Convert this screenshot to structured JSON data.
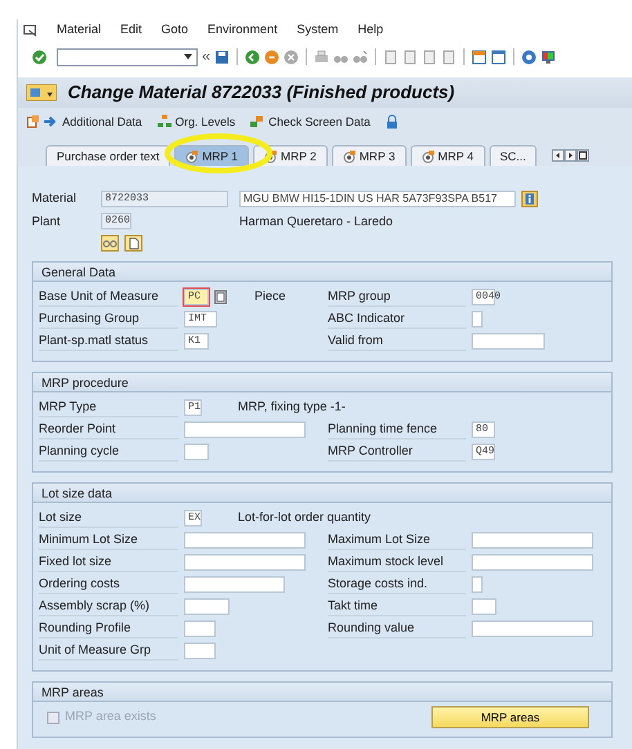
{
  "menu": [
    "Material",
    "Edit",
    "Goto",
    "Environment",
    "System",
    "Help"
  ],
  "toolbar": {
    "history_glyph": "«"
  },
  "title": "Change Material 8722033 (Finished products)",
  "app_toolbar": [
    "Additional Data",
    "Org. Levels",
    "Check Screen Data"
  ],
  "tabs": [
    {
      "label": "Purchase order text",
      "selected": false,
      "kind": "plain"
    },
    {
      "label": "MRP 1",
      "selected": true,
      "kind": "icon"
    },
    {
      "label": "MRP 2",
      "selected": false,
      "kind": "icon"
    },
    {
      "label": "MRP 3",
      "selected": false,
      "kind": "icon"
    },
    {
      "label": "MRP 4",
      "selected": false,
      "kind": "icon"
    },
    {
      "label": "SC...",
      "selected": false,
      "kind": "plain"
    }
  ],
  "header": {
    "material_label": "Material",
    "material": "8722033",
    "description": "MGU BMW HI15-1DIN US HAR 5A73F93SPA B517",
    "plant_label": "Plant",
    "plant": "0260",
    "plant_name": "Harman Queretaro - Laredo"
  },
  "sections": [
    {
      "title": "General Data",
      "rows": [
        {
          "left": {
            "label": "Base Unit of Measure",
            "value": "PC",
            "text": "Piece",
            "focused": true
          },
          "right": {
            "label": "MRP group",
            "value": "0040"
          }
        },
        {
          "left": {
            "label": "Purchasing Group",
            "value": "IMT"
          },
          "right": {
            "label": "ABC Indicator"
          }
        },
        {
          "left": {
            "label": "Plant-sp.matl status",
            "value": "K1"
          },
          "right": {
            "label": "Valid from"
          }
        }
      ]
    },
    {
      "title": "MRP procedure",
      "rows": [
        {
          "left": {
            "label": "MRP Type",
            "value": "P1",
            "text": "MRP, fixing type -1-"
          }
        },
        {
          "left": {
            "label": "Reorder Point"
          },
          "right": {
            "label": "Planning time fence",
            "value": "80"
          }
        },
        {
          "left": {
            "label": "Planning cycle"
          },
          "right": {
            "label": "MRP Controller",
            "value": "Q49"
          }
        }
      ]
    },
    {
      "title": "Lot size data",
      "rows": [
        {
          "left": {
            "label": "Lot size",
            "value": "EX",
            "text": "Lot-for-lot order quantity"
          }
        },
        {
          "left": {
            "label": "Minimum Lot Size"
          },
          "right": {
            "label": "Maximum Lot Size"
          }
        },
        {
          "left": {
            "label": "Fixed lot size"
          },
          "right": {
            "label": "Maximum stock level"
          }
        },
        {
          "left": {
            "label": "Ordering costs"
          },
          "right": {
            "label": "Storage costs ind."
          }
        },
        {
          "left": {
            "label": "Assembly scrap (%)"
          },
          "right": {
            "label": "Takt time"
          }
        },
        {
          "left": {
            "label": "Rounding Profile"
          },
          "right": {
            "label": "Rounding value"
          }
        },
        {
          "left": {
            "label": "Unit of Measure Grp"
          }
        }
      ]
    }
  ],
  "mrp_areas": {
    "title": "MRP areas",
    "checkbox": {
      "label": "MRP area exists",
      "checked": false,
      "disabled": true
    },
    "button": "MRP areas"
  }
}
